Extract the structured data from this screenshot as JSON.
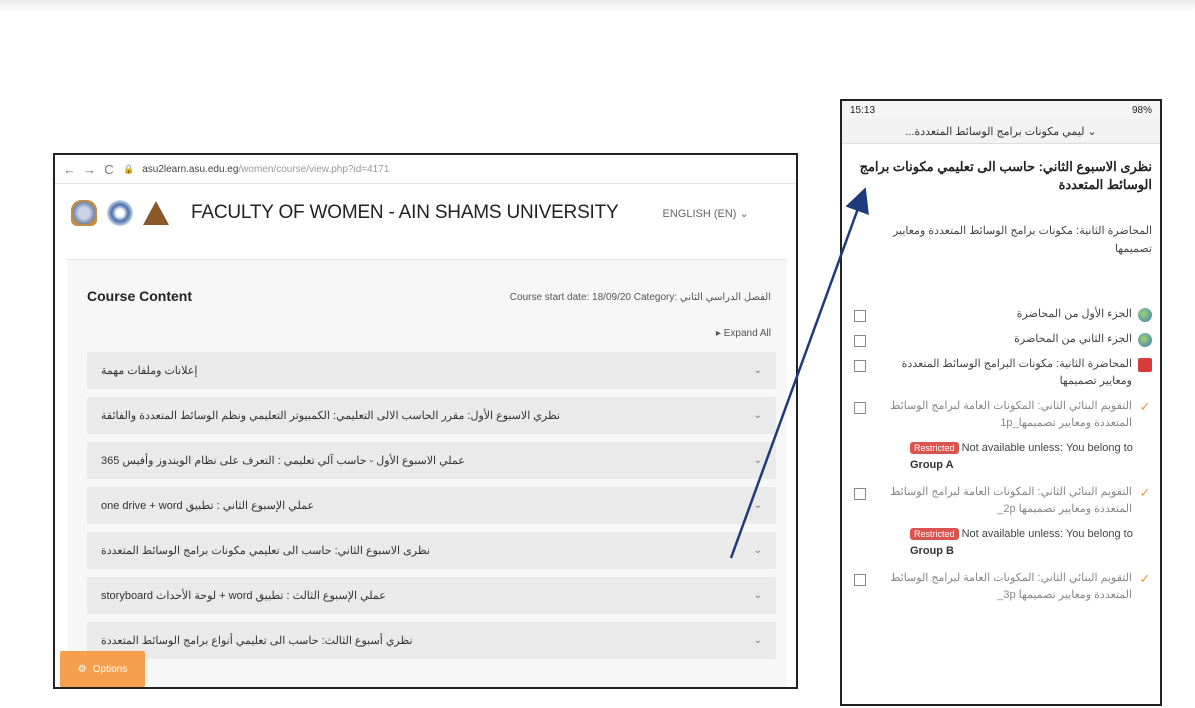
{
  "desktop": {
    "url": {
      "host": "asu2learn.asu.edu.eg",
      "path": "/women/course/view.php?id=4171"
    },
    "site_title": "FACULTY OF WOMEN - AIN SHAMS UNIVERSITY",
    "language": "ENGLISH (EN)",
    "course_content_heading": "Course Content",
    "course_meta": "Course start date: 18/09/20  Category: الفصل الدراسي الثاني",
    "expand_all": "Expand All",
    "sections": [
      "إعلانات وملفات مهمة",
      "نظري الاسبوع الأول: مقرر الحاسب الالى التعليمي: الكمبيوتر التعليمي ونظم الوسائط المتعددة والفائقة",
      "عملي الاسبوع الأول - حاسب آلي تعليمي : التعرف على نظام الويندوز وأفيس 365",
      "one drive + word عملي الإسبوع الثاني : تطبيق",
      "نظرى الاسبوع الثاني: حاسب الى تعليمي مكونات برامج الوسائط المتعددة",
      "storyboard لوحة الأحداث + word عملي الإسبوع الثالث : تطبيق",
      "نظري أسبوع الثالث: حاسب الى تعليمي أنواع برامج الوسائط المتعددة"
    ],
    "options_label": "Options"
  },
  "mobile": {
    "time": "15:13",
    "status_right": "98%",
    "top_select": "...ليمي مكونات برامج الوسائط المتعددة",
    "section_title": "نظرى الاسبوع الثاني: حاسب الى تعليمي مكونات برامج الوسائط المتعددة",
    "lecture_title": "المحاضرة الثانية: مكونات برامج الوسائط المتعددة ومعايير تصميمها",
    "items": [
      {
        "label": "الجزء الأول من المحاضرة",
        "icon": "web-icon"
      },
      {
        "label": "الجزء الثاني من المحاضرة",
        "icon": "web-icon"
      },
      {
        "label": "المحاضرة الثانية: مكونات البرامج الوسائط المتعددة ومعايير تصميمها",
        "icon": "pdf-icon"
      },
      {
        "label": "التقويم البنائي الثاني: المكونات العامة لبرامج الوسائط المتعددة ومعايير تصميمها_1p",
        "icon": "quiz-icon"
      },
      {
        "label": "التقويم البنائي الثاني: المكونات العامة لبرامج الوسائط المتعددة ومعايير تصميمها 2p_",
        "icon": "quiz-icon"
      },
      {
        "label": "التقويم البنائي الثاني: المكونات العامة لبرامج الوسائط المتعددة ومعايير تصميمها 3p_",
        "icon": "quiz-icon"
      }
    ],
    "restricted_badge": "Restricted",
    "restrictions": [
      {
        "text": "Not available unless: You belong to",
        "group": "Group A"
      },
      {
        "text": "Not available unless: You belong to",
        "group": "Group B"
      }
    ]
  },
  "colors": {
    "options_bg": "#f6a04d",
    "restricted_badge": "#d9534f",
    "arrow": "#1f3b7a"
  }
}
